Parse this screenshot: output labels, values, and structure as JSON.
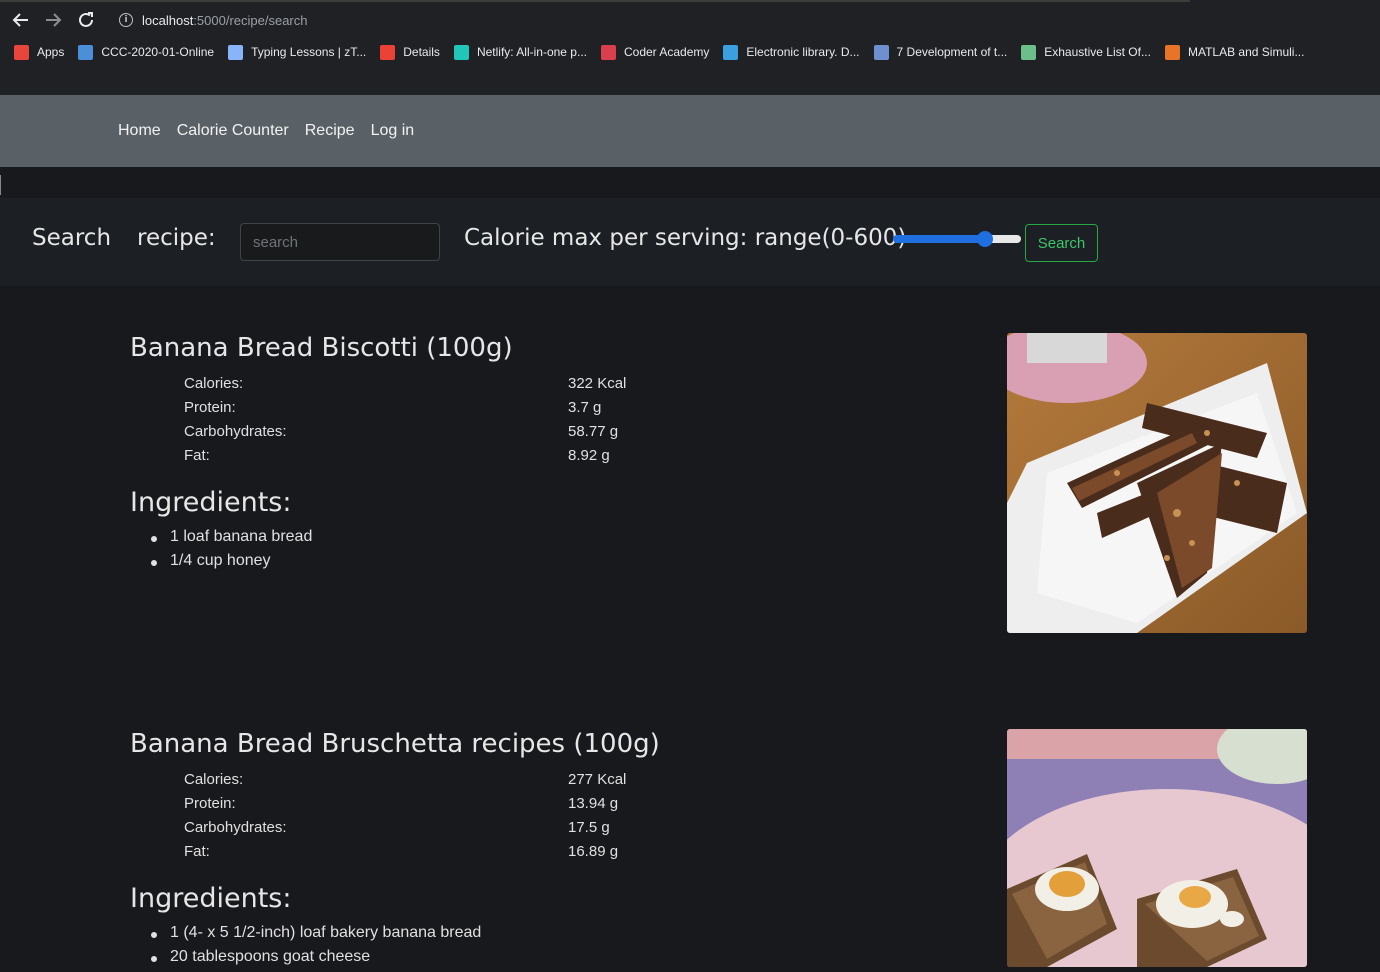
{
  "browser": {
    "url_host": "localhost",
    "url_rest": ":5000/recipe/search",
    "bookmarks": [
      {
        "label": "Apps",
        "icon": "apps-grid-icon",
        "color": "#e8453c"
      },
      {
        "label": "CCC-2020-01-Online",
        "icon": "ccc-icon",
        "color": "#4a8fd8"
      },
      {
        "label": "Typing Lessons | zT...",
        "icon": "typing-icon",
        "color": "#8ab4f8"
      },
      {
        "label": "Details",
        "icon": "google-icon",
        "color": "#ea4335"
      },
      {
        "label": "Netlify: All-in-one p...",
        "icon": "netlify-icon",
        "color": "#20c6b7"
      },
      {
        "label": "Coder Academy",
        "icon": "coder-academy-icon",
        "color": "#d93f4c"
      },
      {
        "label": "Electronic library. D...",
        "icon": "library-icon",
        "color": "#3aa0e0"
      },
      {
        "label": "7 Development of t...",
        "icon": "na-icon",
        "color": "#6f8fcf"
      },
      {
        "label": "Exhaustive List Of...",
        "icon": "frog-icon",
        "color": "#6bbf8a"
      },
      {
        "label": "MATLAB and Simuli...",
        "icon": "matlab-icon",
        "color": "#e8742a"
      }
    ]
  },
  "nav": {
    "links": [
      "Home",
      "Calorie Counter",
      "Recipe",
      "Log in"
    ]
  },
  "search": {
    "label_search": "Search",
    "label_recipe": "recipe:",
    "placeholder": "search",
    "calorie_label": "Calorie max per serving: range(0-600)",
    "slider_fraction": 0.72,
    "button": "Search",
    "accent": "#1f6fe0",
    "button_color": "#28a745"
  },
  "recipes": [
    {
      "title": "Banana Bread Biscotti (100g)",
      "nutrition": [
        {
          "k": "Calories:",
          "v": "322 Kcal"
        },
        {
          "k": "Protein:",
          "v": "3.7 g"
        },
        {
          "k": "Carbohydrates:",
          "v": "58.77 g"
        },
        {
          "k": "Fat:",
          "v": "8.92 g"
        }
      ],
      "ingredients_heading": "Ingredients:",
      "ingredients": [
        "1 loaf banana bread",
        "1/4 cup honey"
      ]
    },
    {
      "title": "Banana Bread Bruschetta recipes (100g)",
      "nutrition": [
        {
          "k": "Calories:",
          "v": "277 Kcal"
        },
        {
          "k": "Protein:",
          "v": "13.94 g"
        },
        {
          "k": "Carbohydrates:",
          "v": "17.5 g"
        },
        {
          "k": "Fat:",
          "v": "16.89 g"
        }
      ],
      "ingredients_heading": "Ingredients:",
      "ingredients": [
        "1 (4- x 5 1/2-inch) loaf bakery banana bread",
        "20 tablespoons goat cheese"
      ]
    }
  ]
}
